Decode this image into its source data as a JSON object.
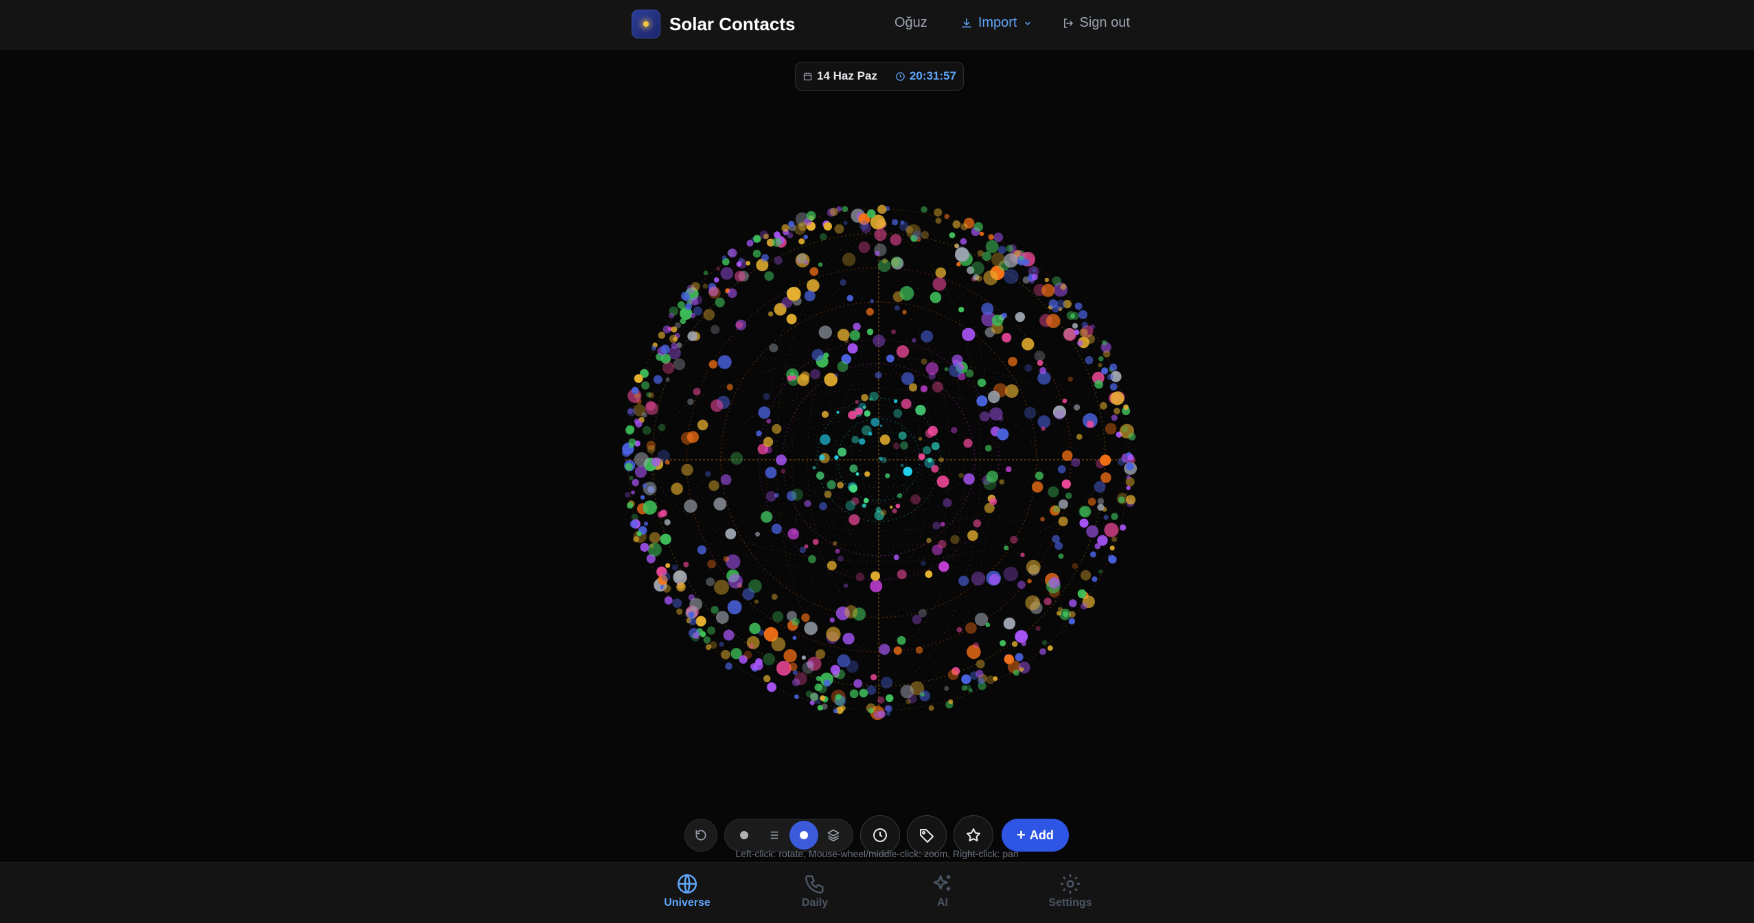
{
  "app": {
    "title": "Solar Contacts"
  },
  "header": {
    "user": "Oğuz",
    "import_label": "Import",
    "signout_label": "Sign out"
  },
  "datetime": {
    "date": "14 Haz Paz",
    "time": "20:31:57"
  },
  "toolbar": {
    "add_label": "Add",
    "hint": "Left-click: rotate, Mouse-wheel/middle-click: zoom, Right-click: pan"
  },
  "bottom_nav": [
    {
      "label": "Universe",
      "icon": "globe-icon",
      "active": true
    },
    {
      "label": "Daily",
      "icon": "phone-icon",
      "active": false
    },
    {
      "label": "AI",
      "icon": "sparkles-icon",
      "active": false
    },
    {
      "label": "Settings",
      "icon": "gear-icon",
      "active": false
    }
  ],
  "colors": {
    "accent": "#3b5bdb",
    "link": "#60a5fa",
    "node_palette": [
      "#e6b030",
      "#4a63e0",
      "#3fbf5a",
      "#a855f7",
      "#ec4899",
      "#f97316",
      "#9ca3af",
      "#22d3ee"
    ]
  }
}
